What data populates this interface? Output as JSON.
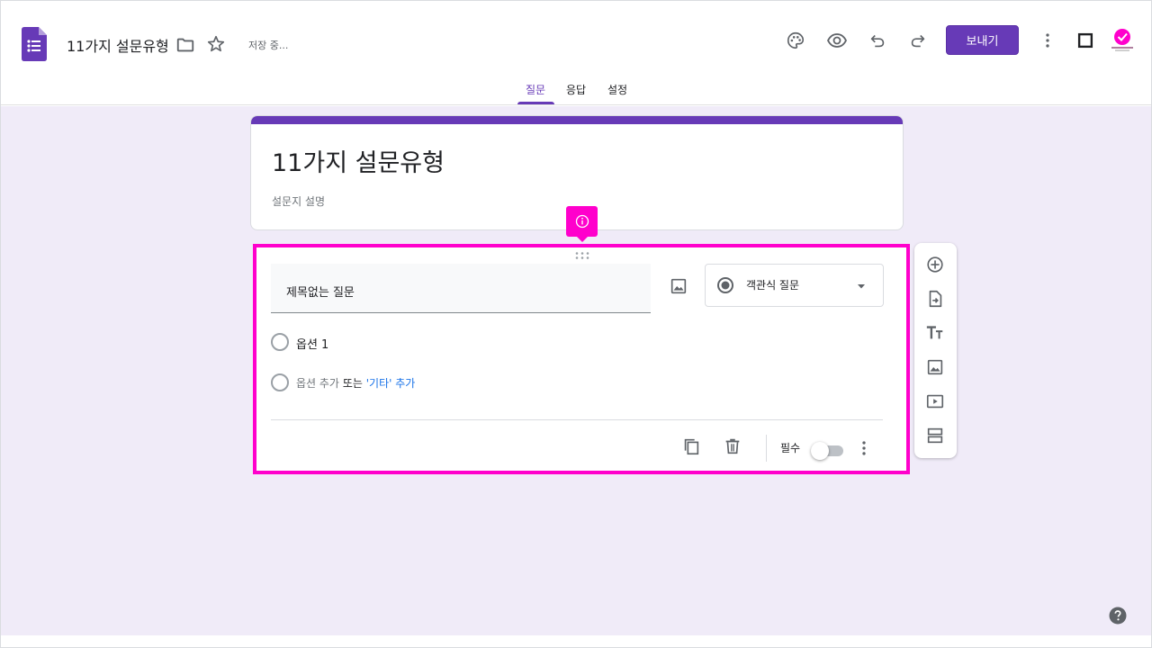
{
  "header": {
    "doc_title": "11가지 설문유형",
    "save_status": "저장 중...",
    "send_label": "보내기"
  },
  "tabs": [
    {
      "label": "질문",
      "active": true
    },
    {
      "label": "응답",
      "active": false
    },
    {
      "label": "설정",
      "active": false
    }
  ],
  "form": {
    "title": "11가지 설문유형",
    "description": "설문지 설명"
  },
  "question": {
    "title": "제목없는 질문",
    "type_label": "객관식 질문",
    "options": [
      {
        "label": "옵션 1"
      }
    ],
    "add_option": {
      "add_text": "옵션 추가",
      "or_text": "또는",
      "add_other_text": "'기타' 추가"
    },
    "required_label": "필수",
    "required": false
  },
  "colors": {
    "accent": "#673ab7",
    "background": "#f0ebf8",
    "highlight": "#ff00cc",
    "link": "#1a73e8"
  },
  "icons": {
    "header": [
      "forms-logo-icon",
      "folder-icon",
      "star-icon",
      "palette-icon",
      "preview-eye-icon",
      "undo-icon",
      "redo-icon",
      "more-vert-icon",
      "square-icon"
    ],
    "side_toolbar": [
      "add-question-icon",
      "import-questions-icon",
      "add-title-icon",
      "add-image-icon",
      "add-video-icon",
      "add-section-icon"
    ],
    "question_footer": [
      "duplicate-icon",
      "delete-icon",
      "more-vert-icon"
    ]
  }
}
